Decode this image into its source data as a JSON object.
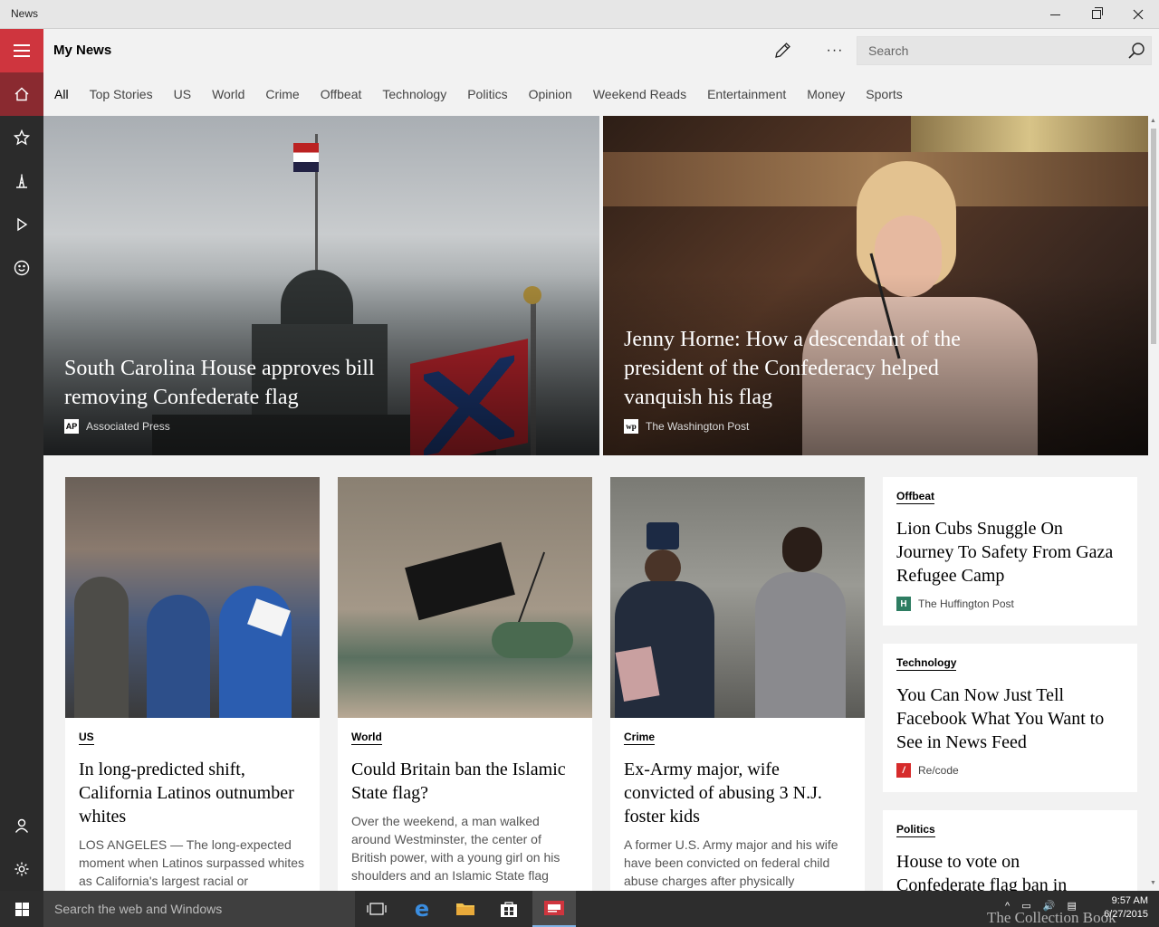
{
  "window": {
    "title": "News"
  },
  "header": {
    "title": "My News",
    "search_placeholder": "Search"
  },
  "tabs": [
    "All",
    "Top Stories",
    "US",
    "World",
    "Crime",
    "Offbeat",
    "Technology",
    "Politics",
    "Opinion",
    "Weekend Reads",
    "Entertainment",
    "Money",
    "Sports"
  ],
  "hero": [
    {
      "title": "South Carolina House approves bill removing Confederate flag",
      "source": "Associated Press",
      "logo": "AP"
    },
    {
      "title": "Jenny Horne: How a descendant of the president of the Confederacy helped vanquish his flag",
      "source": "The Washington Post",
      "logo": "wp"
    }
  ],
  "cards": [
    {
      "category": "US",
      "title": "In long-predicted shift, California Latinos outnumber whites",
      "snippet": "LOS ANGELES — The long-expected moment when Latinos surpassed whites as California's largest racial or"
    },
    {
      "category": "World",
      "title": "Could Britain ban the Islamic State flag?",
      "snippet": "Over the weekend, a man walked around Westminster, the center of British power, with a young girl on his shoulders and an Islamic State flag"
    },
    {
      "category": "Crime",
      "title": "Ex-Army major, wife convicted of abusing 3 N.J. foster kids",
      "snippet": "A former U.S. Army major and his wife have been convicted on federal child abuse charges after physically"
    }
  ],
  "side_cards": [
    {
      "category": "Offbeat",
      "title": "Lion Cubs Snuggle On Journey To Safety From Gaza Refugee Camp",
      "source": "The Huffington Post",
      "logo": "H",
      "logo_color": "#2e7d62"
    },
    {
      "category": "Technology",
      "title": "You Can Now Just Tell Facebook What You Want to See in News Feed",
      "source": "Re/code",
      "logo": "/",
      "logo_color": "#d62b2b"
    },
    {
      "category": "Politics",
      "title": "House to vote on Confederate flag ban in"
    }
  ],
  "taskbar": {
    "search_placeholder": "Search the web and Windows",
    "time": "9:57 AM",
    "date": "6/27/2015"
  },
  "watermark": "The Collection Book",
  "colors": {
    "accent": "#cf353e",
    "sidebar": "#2b2b2b",
    "taskbar": "#2d2d2d"
  }
}
